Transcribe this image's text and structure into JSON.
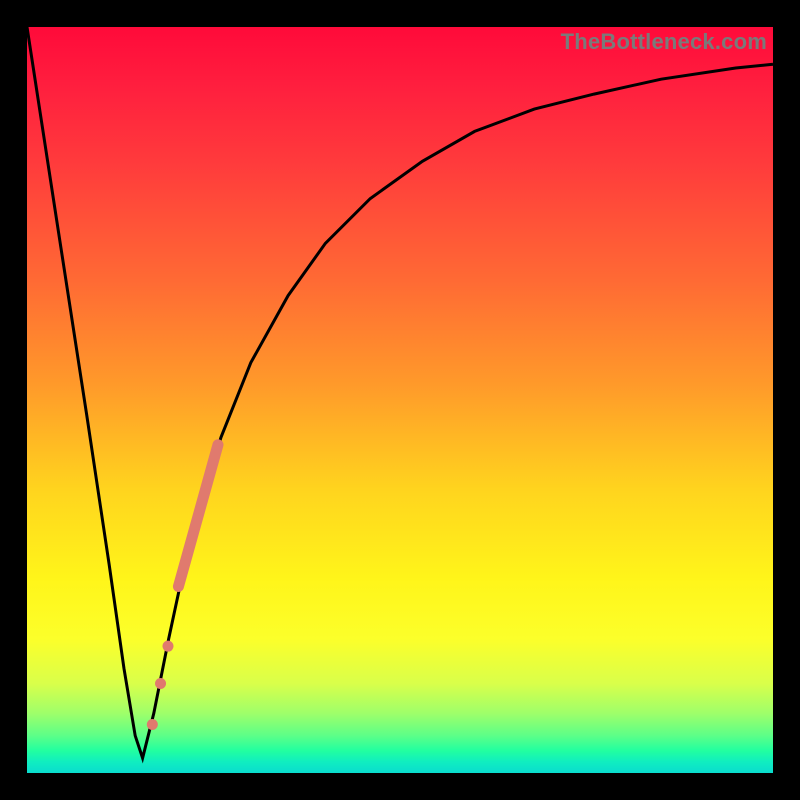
{
  "watermark": "TheBottleneck.com",
  "chart_data": {
    "type": "line",
    "title": "",
    "xlabel": "",
    "ylabel": "",
    "xlim": [
      0,
      100
    ],
    "ylim": [
      0,
      100
    ],
    "grid": false,
    "legend": false,
    "series": [
      {
        "name": "bottleneck-curve",
        "x": [
          0,
          4,
          8,
          11,
          13,
          14.5,
          15.5,
          17,
          19,
          22,
          26,
          30,
          35,
          40,
          46,
          53,
          60,
          68,
          76,
          85,
          95,
          100
        ],
        "values": [
          100,
          74,
          48,
          28,
          14,
          5,
          2,
          8,
          18,
          32,
          45,
          55,
          64,
          71,
          77,
          82,
          86,
          89,
          91,
          93,
          94.5,
          95
        ],
        "color": "#000000"
      }
    ],
    "overlay_points": {
      "name": "highlighted-samples",
      "color": "#e07a6e",
      "segments": [
        {
          "x0": 20.3,
          "y0": 25,
          "x1": 25.6,
          "y1": 44
        }
      ],
      "dots": [
        {
          "x": 16.8,
          "y": 6.5
        },
        {
          "x": 17.9,
          "y": 12.0
        },
        {
          "x": 18.9,
          "y": 17.0
        }
      ]
    },
    "background_gradient": {
      "top": "#ff0a3a",
      "middle": "#fff51a",
      "bottom": "#0adccf"
    }
  }
}
